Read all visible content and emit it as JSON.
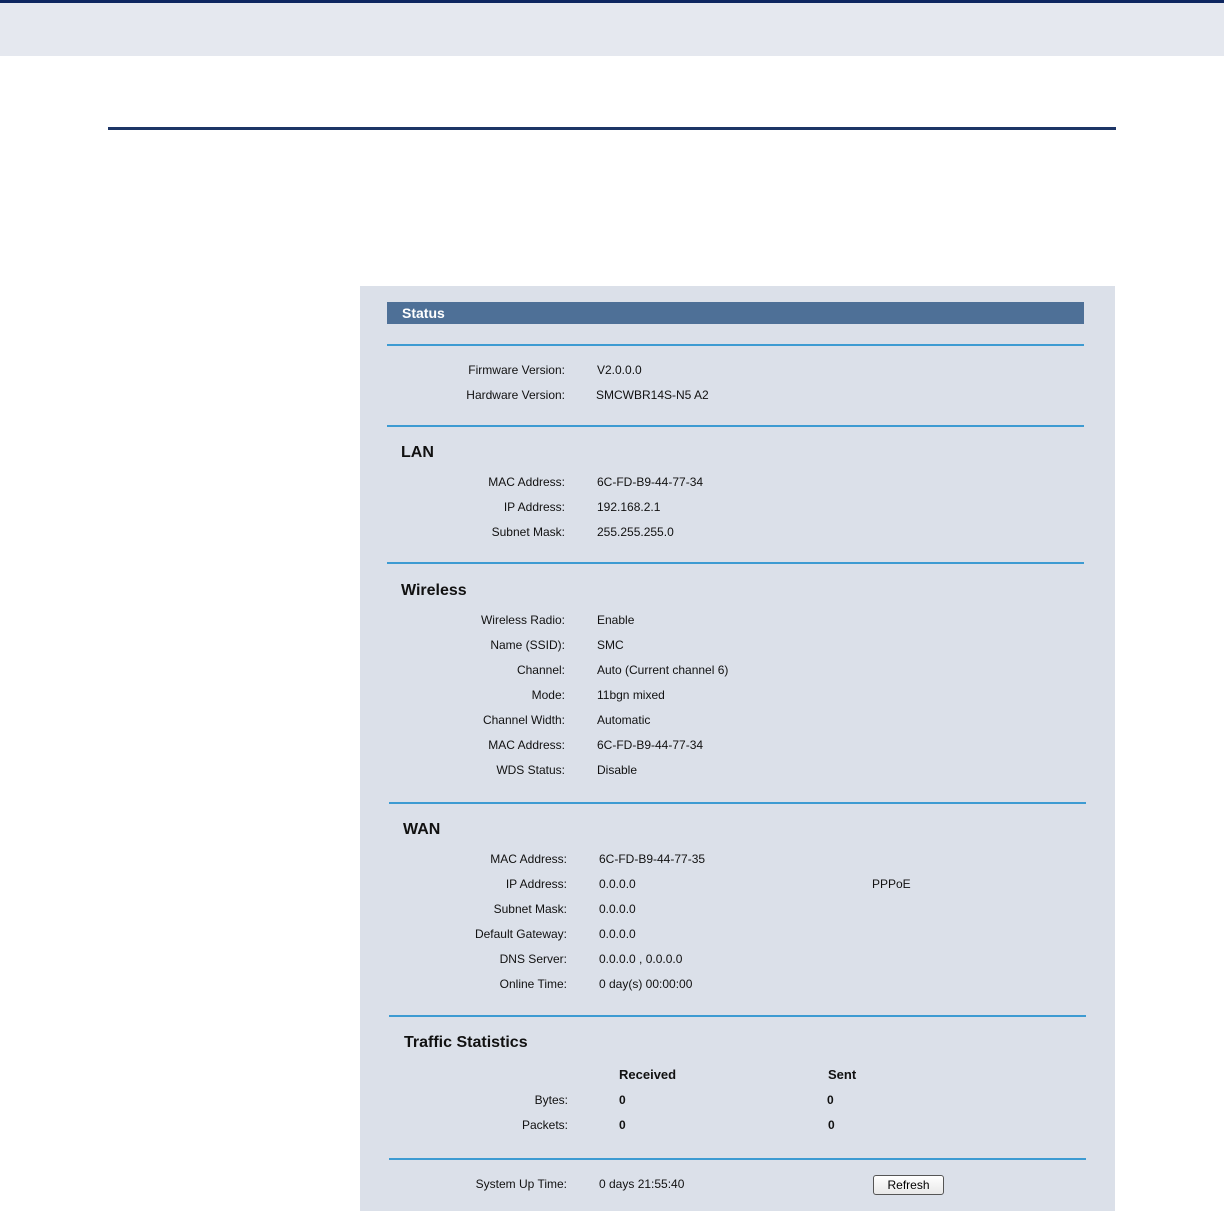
{
  "status": {
    "title": "Status"
  },
  "versions": {
    "firmware_label": "Firmware Version:",
    "firmware_value": "V2.0.0.0",
    "hardware_label": "Hardware Version:",
    "hardware_value": "SMCWBR14S-N5 A2"
  },
  "lan": {
    "title": "LAN",
    "mac_label": "MAC Address:",
    "mac_value": "6C-FD-B9-44-77-34",
    "ip_label": "IP Address:",
    "ip_value": "192.168.2.1",
    "mask_label": "Subnet Mask:",
    "mask_value": "255.255.255.0"
  },
  "wireless": {
    "title": "Wireless",
    "radio_label": "Wireless Radio:",
    "radio_value": "Enable",
    "ssid_label": "Name (SSID):",
    "ssid_value": "SMC",
    "channel_label": "Channel:",
    "channel_value": "Auto (Current channel 6)",
    "mode_label": "Mode:",
    "mode_value": "11bgn mixed",
    "width_label": "Channel Width:",
    "width_value": "Automatic",
    "mac_label": "MAC Address:",
    "mac_value": "6C-FD-B9-44-77-34",
    "wds_label": "WDS Status:",
    "wds_value": "Disable"
  },
  "wan": {
    "title": "WAN",
    "mac_label": "MAC Address:",
    "mac_value": "6C-FD-B9-44-77-35",
    "ip_label": "IP Address:",
    "ip_value": "0.0.0.0",
    "conn_type": "PPPoE",
    "mask_label": "Subnet Mask:",
    "mask_value": "0.0.0.0",
    "gw_label": "Default Gateway:",
    "gw_value": "0.0.0.0",
    "dns_label": "DNS Server:",
    "dns_value": "0.0.0.0 , 0.0.0.0",
    "online_label": "Online Time:",
    "online_value": "0 day(s) 00:00:00"
  },
  "traffic": {
    "title": "Traffic Statistics",
    "received_header": "Received",
    "sent_header": "Sent",
    "bytes_label": "Bytes:",
    "bytes_received": "0",
    "bytes_sent": "0",
    "packets_label": "Packets:",
    "packets_received": "0",
    "packets_sent": "0"
  },
  "system": {
    "uptime_label": "System Up Time:",
    "uptime_value": "0 days 21:55:40",
    "refresh_label": "Refresh"
  },
  "colors": {
    "section_line": "#3d9bd2",
    "status_bar": "#4e7097",
    "panel_bg": "#dbe0e9"
  }
}
